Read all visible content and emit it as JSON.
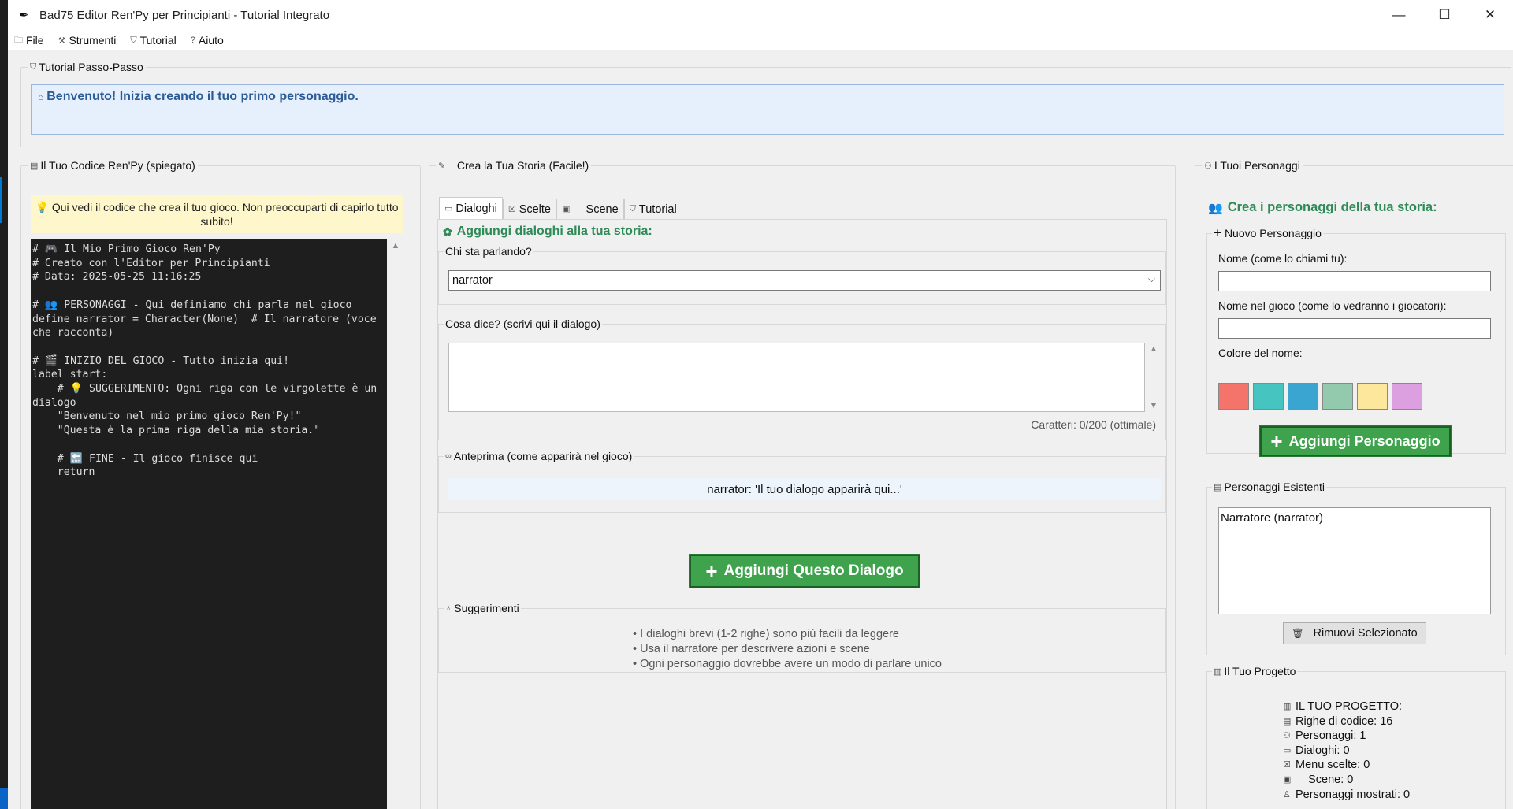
{
  "window": {
    "title": "Bad75 Editor Ren'Py per Principianti - Tutorial Integrato",
    "icon": "feather-icon",
    "controls": {
      "minimize": "—",
      "maximize": "☐",
      "close": "✕"
    }
  },
  "menu": {
    "items": [
      {
        "label": "File",
        "icon": "folder-icon"
      },
      {
        "label": "Strumenti",
        "icon": "tools-icon"
      },
      {
        "label": "Tutorial",
        "icon": "graduation-cap-icon"
      },
      {
        "label": "Aiuto",
        "icon": "question-icon"
      }
    ]
  },
  "tutorial": {
    "legend": "Tutorial Passo-Passo",
    "message": "Benvenuto! Inizia creando il tuo primo personaggio."
  },
  "code": {
    "legend": "Il Tuo Codice Ren'Py (spiegato)",
    "hint": "💡 Qui vedi il codice che crea il tuo gioco. Non preoccuparti di capirlo tutto subito!",
    "text": "# 🎮 Il Mio Primo Gioco Ren'Py\n# Creato con l'Editor per Principianti\n# Data: 2025-05-25 11:16:25\n\n# 👥 PERSONAGGI - Qui definiamo chi parla nel gioco\ndefine narrator = Character(None)  # Il narratore (voce che racconta)\n\n# 🎬 INIZIO DEL GIOCO - Tutto inizia qui!\nlabel start:\n    # 💡 SUGGERIMENTO: Ogni riga con le virgolette è un dialogo\n    \"Benvenuto nel mio primo gioco Ren'Py!\"\n    \"Questa è la prima riga della mia storia.\"\n\n    # 🔚 FINE - Il gioco finisce qui\n    return"
  },
  "story": {
    "legend": "Crea la Tua Storia (Facile!)",
    "tabs": [
      {
        "label": "Dialoghi",
        "icon": "speech-bubble-icon",
        "active": true
      },
      {
        "label": "Scelte",
        "icon": "choice-box-icon",
        "active": false
      },
      {
        "label": "Scene",
        "icon": "camera-icon",
        "active": false
      },
      {
        "label": "Tutorial",
        "icon": "graduation-cap-icon",
        "active": false
      }
    ],
    "section_title": "Aggiungi dialoghi alla tua storia:",
    "speaker_legend": "Chi sta parlando?",
    "speaker_value": "narrator",
    "text_legend": "Cosa dice? (scrivi qui il dialogo)",
    "text_value": "",
    "char_count": "Caratteri: 0/200 (ottimale)",
    "preview_legend": "Anteprima (come apparirà nel gioco)",
    "preview_text": "narrator: 'Il tuo dialogo apparirà qui...'",
    "add_button": "Aggiungi Questo Dialogo",
    "tips_legend": "Suggerimenti",
    "tips": [
      "• I dialoghi brevi (1-2 righe) sono più facili da leggere",
      "• Usa il narratore per descrivere azioni e scene",
      "• Ogni personaggio dovrebbe avere un modo di parlare unico"
    ]
  },
  "characters": {
    "legend": "I Tuoi Personaggi",
    "title": "Crea i personaggi della tua storia:",
    "new_legend": "Nuovo Personaggio",
    "name_label": "Nome (come lo chiami tu):",
    "display_label": "Nome nel gioco (come lo vedranno i giocatori):",
    "color_label": "Colore del nome:",
    "colors": [
      "#f4736b",
      "#45c4c0",
      "#3aa5d1",
      "#93c9ad",
      "#fde79c",
      "#dca0e0"
    ],
    "add_button": "Aggiungi Personaggio",
    "existing_legend": "Personaggi Esistenti",
    "existing": [
      "Narratore (narrator)"
    ],
    "remove_button": "Rimuovi Selezionato",
    "project_legend": "Il Tuo Progetto",
    "project": [
      {
        "icon": "bar-chart-icon",
        "text": "IL TUO PROGETTO:"
      },
      {
        "icon": "document-icon",
        "text": "Righe di codice: 16"
      },
      {
        "icon": "people-icon",
        "text": "Personaggi: 1"
      },
      {
        "icon": "speech-bubble-icon",
        "text": "Dialoghi: 0"
      },
      {
        "icon": "choice-box-icon",
        "text": "Menu scelte: 0"
      },
      {
        "icon": "camera-icon",
        "text": "    Scene: 0"
      },
      {
        "icon": "person-icon",
        "text": "Personaggi mostrati: 0"
      }
    ]
  }
}
